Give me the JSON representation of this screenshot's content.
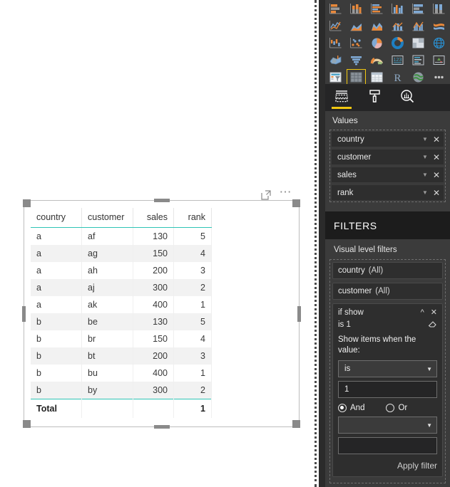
{
  "visual": {
    "header_icons": [
      "focus-mode-icon",
      "more-options-icon"
    ],
    "table": {
      "columns": [
        {
          "key": "country",
          "label": "country",
          "align": "left"
        },
        {
          "key": "customer",
          "label": "customer",
          "align": "left"
        },
        {
          "key": "sales",
          "label": "sales",
          "align": "right"
        },
        {
          "key": "rank",
          "label": "rank",
          "align": "right"
        }
      ],
      "rows": [
        [
          "a",
          "af",
          "130",
          "5"
        ],
        [
          "a",
          "ag",
          "150",
          "4"
        ],
        [
          "a",
          "ah",
          "200",
          "3"
        ],
        [
          "a",
          "aj",
          "300",
          "2"
        ],
        [
          "a",
          "ak",
          "400",
          "1"
        ],
        [
          "b",
          "be",
          "130",
          "5"
        ],
        [
          "b",
          "br",
          "150",
          "4"
        ],
        [
          "b",
          "bt",
          "200",
          "3"
        ],
        [
          "b",
          "bu",
          "400",
          "1"
        ],
        [
          "b",
          "by",
          "300",
          "2"
        ]
      ],
      "total_row": [
        "Total",
        "",
        "",
        "1"
      ],
      "accent_color": "#2ec4b6"
    }
  },
  "panel": {
    "gallery": {
      "icons": [
        "stacked-bar-chart-icon",
        "stacked-column-chart-icon",
        "clustered-bar-chart-icon",
        "clustered-column-chart-icon",
        "100-stacked-bar-chart-icon",
        "100-stacked-column-chart-icon",
        "line-chart-icon",
        "area-chart-icon",
        "stacked-area-chart-icon",
        "line-and-stacked-column-chart-icon",
        "line-and-clustered-column-chart-icon",
        "ribbon-chart-icon",
        "waterfall-chart-icon",
        "scatter-chart-icon",
        "pie-chart-icon",
        "donut-chart-icon",
        "treemap-icon",
        "map-icon",
        "filled-map-icon",
        "funnel-icon",
        "gauge-icon",
        "card-icon",
        "multi-row-card-icon",
        "kpi-icon",
        "slicer-icon",
        "table-icon",
        "matrix-icon",
        "r-script-visual-icon",
        "arcgis-map-icon",
        "more-visuals-icon"
      ],
      "selected_index": 25,
      "selected_color": "#f2c811"
    },
    "tabs": [
      {
        "name": "fields-tab",
        "icon": "fields-icon",
        "active": true
      },
      {
        "name": "format-tab",
        "icon": "paint-roller-icon",
        "active": false
      },
      {
        "name": "analytics-tab",
        "icon": "analytics-magnifier-icon",
        "active": false
      }
    ],
    "values": {
      "title": "Values",
      "wells": [
        {
          "label": "country"
        },
        {
          "label": "customer"
        },
        {
          "label": "sales"
        },
        {
          "label": "rank"
        }
      ]
    },
    "filters": {
      "header": "FILTERS",
      "subtitle": "Visual level filters",
      "cards": [
        {
          "name": "country",
          "state": "(All)",
          "expanded": false
        },
        {
          "name": "customer",
          "state": "(All)",
          "expanded": false
        }
      ],
      "expanded_card": {
        "name": "if show",
        "summary": "is 1",
        "prompt": "Show items when the value:",
        "operator": "is",
        "value": "1",
        "and_label": "And",
        "or_label": "Or",
        "and_selected": true,
        "operator2": "",
        "value2": "",
        "apply_label": "Apply filter"
      }
    }
  }
}
